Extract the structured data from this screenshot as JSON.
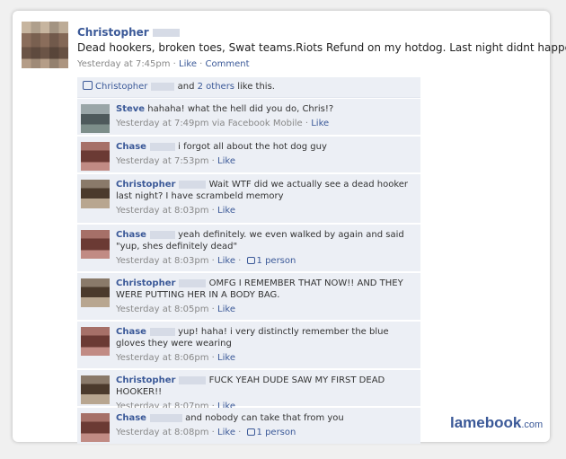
{
  "post": {
    "author": "Christopher",
    "text": "Dead hookers, broken toes, Swat teams.Riots Refund on my hotdog. Last night didnt happen.",
    "time": "Yesterday at 7:45pm",
    "like_label": "Like",
    "comment_label": "Comment"
  },
  "likes": {
    "name": "Christopher",
    "and": "and",
    "others": "2 others",
    "suffix": "like this."
  },
  "comments": [
    {
      "author": "Steve",
      "avatar": "steve",
      "text": "hahaha! what the hell did you do, Chris!?",
      "time": "Yesterday at 7:49pm",
      "via": "via Facebook Mobile",
      "like": "Like",
      "likes_count": ""
    },
    {
      "author": "Chase",
      "avatar": "chase",
      "text": "i forgot all about the hot dog guy",
      "time": "Yesterday at 7:53pm",
      "via": "",
      "like": "Like",
      "likes_count": ""
    },
    {
      "author": "Christopher",
      "avatar": "chris",
      "text": "Wait WTF did we actually see a dead hooker last night? I have scrambeld memory",
      "time": "Yesterday at 8:03pm",
      "via": "",
      "like": "Like",
      "likes_count": ""
    },
    {
      "author": "Chase",
      "avatar": "chase",
      "text": "yeah definitely. we even walked by again and said \"yup, shes definitely dead\"",
      "time": "Yesterday at 8:03pm",
      "via": "",
      "like": "Like",
      "likes_count": "1 person"
    },
    {
      "author": "Christopher",
      "avatar": "chris",
      "text": "OMFG I REMEMBER THAT NOW!! AND THEY WERE PUTTING HER IN A BODY BAG.",
      "time": "Yesterday at 8:05pm",
      "via": "",
      "like": "Like",
      "likes_count": ""
    },
    {
      "author": "Chase",
      "avatar": "chase",
      "text": "yup! haha! i very distinctly remember the blue gloves they were wearing",
      "time": "Yesterday at 8:06pm",
      "via": "",
      "like": "Like",
      "likes_count": ""
    },
    {
      "author": "Christopher",
      "avatar": "chris",
      "text": "FUCK YEAH DUDE SAW MY FIRST DEAD HOOKER!!",
      "time": "Yesterday at 8:07pm",
      "via": "",
      "like": "Like",
      "likes_count": ""
    },
    {
      "author": "Chase",
      "avatar": "chase",
      "text": "and nobody can take that from you",
      "time": "Yesterday at 8:08pm",
      "via": "",
      "like": "Like",
      "likes_count": "1 person"
    }
  ],
  "watermark": {
    "brand": "lamebook",
    "tld": ".com"
  },
  "colors": {
    "link": "#3b5998",
    "comment_bg": "#eceff5",
    "meta": "#888888"
  }
}
